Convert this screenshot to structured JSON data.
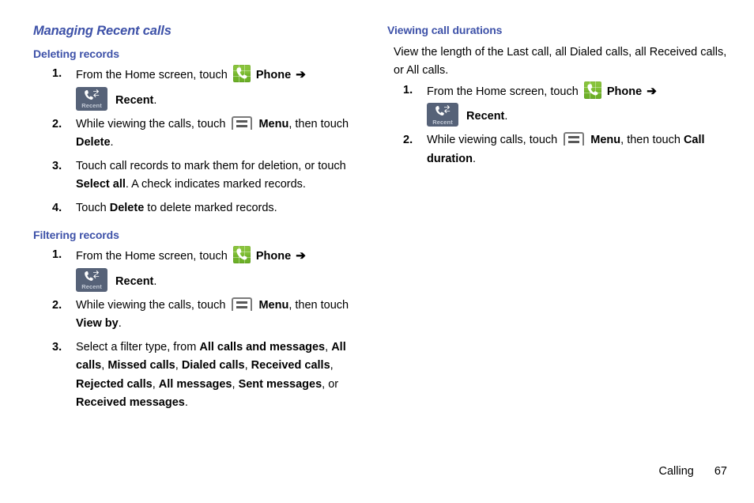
{
  "page": {
    "footer": {
      "chapter": "Calling",
      "page_number": "67"
    }
  },
  "icons": {
    "phone": "phone-app-icon",
    "recent": "recent-tab-icon",
    "recent_label": "Recent",
    "menu": "menu-key-icon",
    "arrow": "➔"
  },
  "colors": {
    "heading_blue": "#3d51a8",
    "phone_icon_green": "#7fbe35",
    "recent_tile_slate": "#566278",
    "menu_key_gray": "#7a7a7a",
    "body_text": "#000000"
  },
  "left_column": {
    "section_title": "Managing Recent calls",
    "subsections": [
      {
        "title": "Deleting records",
        "steps": [
          {
            "num": "1.",
            "t1": "From the Home screen, touch",
            "b1": "Phone",
            "b2": "Recent",
            "t2": "."
          },
          {
            "num": "2.",
            "t1": "While viewing the calls, touch",
            "b1": "Menu",
            "t2": ", then touch",
            "b2": "Delete",
            "t3": "."
          },
          {
            "num": "3.",
            "t1": "Touch call records to mark them for deletion, or touch",
            "b1": "Select all",
            "t2": ". A check indicates marked records."
          },
          {
            "num": "4.",
            "t1": "Touch",
            "b1": "Delete",
            "t2": " to delete marked records."
          }
        ]
      },
      {
        "title": "Filtering records",
        "steps": [
          {
            "num": "1.",
            "t1": "From the Home screen, touch",
            "b1": "Phone",
            "b2": "Recent",
            "t2": "."
          },
          {
            "num": "2.",
            "t1": "While viewing the calls, touch",
            "b1": "Menu",
            "t2": ", then touch",
            "b2": "View by",
            "t3": "."
          },
          {
            "num": "3.",
            "t1": "Select a filter type, from",
            "options": [
              "All calls and messages",
              "All calls",
              "Missed calls",
              "Dialed calls",
              "Received calls",
              "Rejected calls",
              "All messages",
              "Sent messages",
              "Received messages"
            ],
            "conjunction": "or",
            "t2": "."
          }
        ]
      }
    ]
  },
  "right_column": {
    "subsections": [
      {
        "title": "Viewing call durations",
        "lead": "View the length of the Last call, all Dialed calls, all Received calls, or All calls.",
        "steps": [
          {
            "num": "1.",
            "t1": "From the Home screen, touch",
            "b1": "Phone",
            "b2": "Recent",
            "t2": "."
          },
          {
            "num": "2.",
            "t1": "While viewing calls, touch",
            "b1": "Menu",
            "t2": ", then touch",
            "b2": "Call duration",
            "t3": "."
          }
        ]
      }
    ]
  }
}
